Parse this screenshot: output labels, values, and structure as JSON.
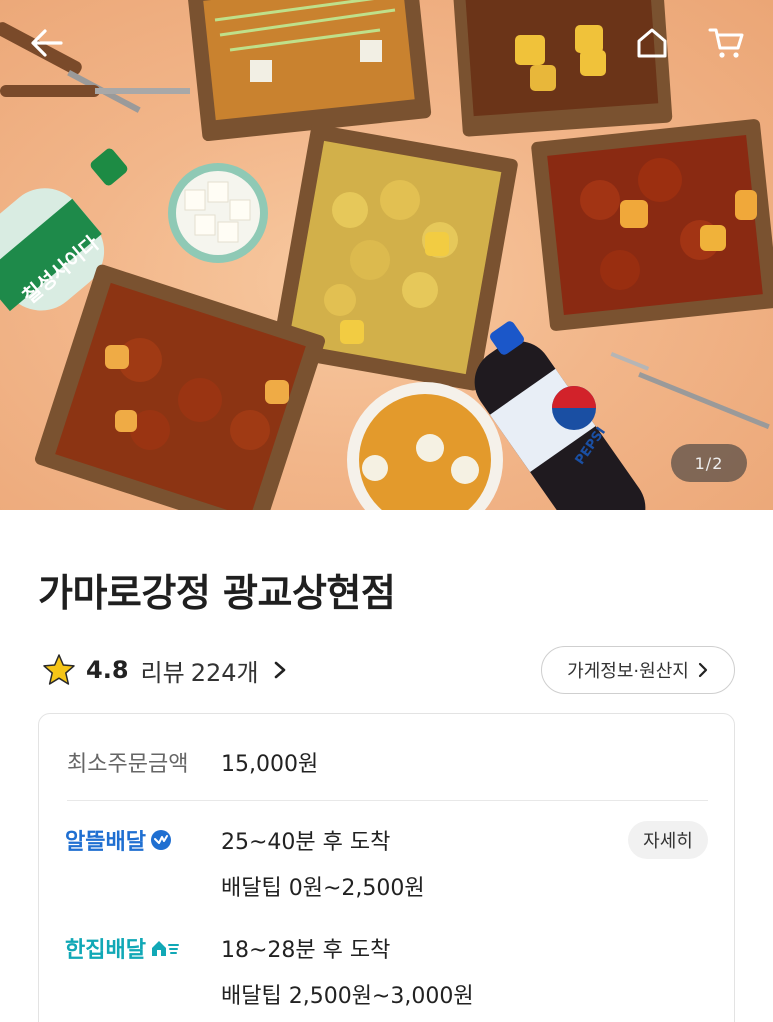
{
  "header": {
    "image_counter": "1/2",
    "back_icon": "arrow-left-icon",
    "home_icon": "home-icon",
    "cart_icon": "cart-icon"
  },
  "hero": {
    "bottle_label_green": "칠성사이다",
    "bottle_label_blue": "PEPSI"
  },
  "store": {
    "name": "가마로강정 광교상현점",
    "rating": "4.8",
    "review_label": "리뷰",
    "review_count": "224개",
    "info_button": "가게정보·원산지"
  },
  "delivery": {
    "min_order_label": "최소주문금액",
    "min_order_value": "15,000원",
    "options": [
      {
        "name": "알뜰배달",
        "time": "25~40분 후 도착",
        "tip": "배달팁 0원~2,500원",
        "detail_button": "자세히"
      },
      {
        "name": "한집배달",
        "time": "18~28분 후 도착",
        "tip": "배달팁 2,500원~3,000원"
      }
    ]
  },
  "colors": {
    "star": "#f5c518",
    "alttle": "#1f6fd1",
    "hanjip": "#11a8b6",
    "hero_bg": "#f2b68a"
  }
}
